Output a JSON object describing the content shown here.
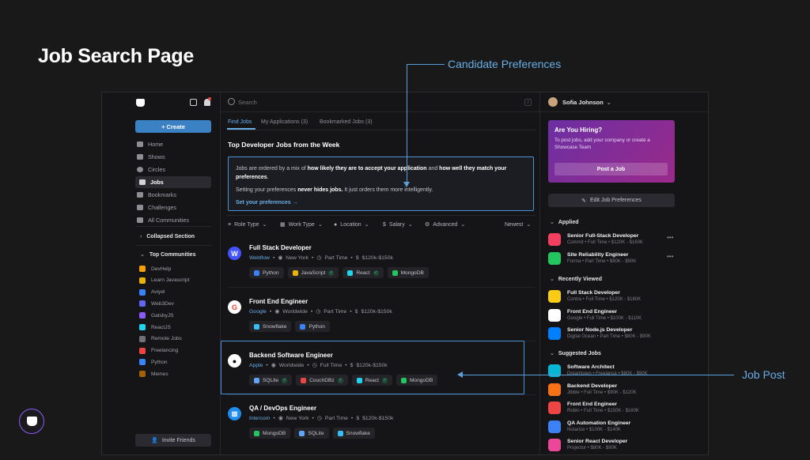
{
  "page_title": "Job Search Page",
  "callouts": {
    "preferences": "Candidate Preferences",
    "job_post": "Job Post"
  },
  "sidebar": {
    "create_label": "+ Create",
    "nav": [
      "Home",
      "Shows",
      "Circles",
      "Jobs",
      "Bookmarks",
      "Challenges",
      "All Communities"
    ],
    "collapsed_section": "Collapsed Section",
    "top_communities": "Top Communities",
    "communities": [
      {
        "name": "DevHelp",
        "color": "#f59e0b"
      },
      {
        "name": "Learn Javascript",
        "color": "#eab308"
      },
      {
        "name": "Aviyel",
        "color": "#3b82f6"
      },
      {
        "name": "Web3Dev",
        "color": "#6366f1"
      },
      {
        "name": "GatsbyJS",
        "color": "#8b5cf6"
      },
      {
        "name": "ReactJS",
        "color": "#22d3ee"
      },
      {
        "name": "Remote Jobs",
        "color": "#71717a"
      },
      {
        "name": "Freelancing",
        "color": "#ef4444"
      },
      {
        "name": "Python",
        "color": "#3b82f6"
      },
      {
        "name": "Memes",
        "color": "#a16207"
      }
    ],
    "invite_label": "Invite Friends"
  },
  "search": {
    "placeholder": "Search",
    "shortcut": "/"
  },
  "tabs": [
    "Find Jobs",
    "My Applications (3)",
    "Bookmarked Jobs (3)"
  ],
  "section_title": "Top Developer Jobs from the Week",
  "info_box": {
    "p1_a": "Jobs are ordered by a mix of ",
    "p1_b": "how likely they are to accept your application",
    "p1_c": " and ",
    "p1_d": "how well they match your preferences",
    "p1_e": ".",
    "p2_a": "Setting your preferences ",
    "p2_b": "never hides jobs.",
    "p2_c": " It just orders them more intelligently.",
    "link": "Set your preferences →"
  },
  "filters": [
    "Role Type",
    "Work Type",
    "Location",
    "Salary",
    "Advanced"
  ],
  "sort": "Newest",
  "jobs": [
    {
      "title": "Full Stack Developer",
      "company": "Webflow",
      "location": "New York",
      "type": "Part Time",
      "salary": "$120k-$150k",
      "logo_color": "#4353ff",
      "logo_text": "W",
      "tags": [
        {
          "name": "Python",
          "color": "#3b82f6",
          "check": false
        },
        {
          "name": "JavaScript",
          "color": "#eab308",
          "check": true
        },
        {
          "name": "React",
          "color": "#22d3ee",
          "check": true
        },
        {
          "name": "MongoDB",
          "color": "#22c55e",
          "check": false
        }
      ]
    },
    {
      "title": "Front End Engineer",
      "company": "Google",
      "location": "Worldwide",
      "type": "Part Time",
      "salary": "$120k-$150k",
      "logo_color": "#ffffff",
      "logo_text": "G",
      "tags": [
        {
          "name": "Snowflake",
          "color": "#38bdf8",
          "check": false
        },
        {
          "name": "Python",
          "color": "#3b82f6",
          "check": false
        }
      ]
    },
    {
      "title": "Backend Software Engineer",
      "company": "Apple",
      "location": "Worldwide",
      "type": "Full Time",
      "salary": "$120k-$150k",
      "logo_color": "#ffffff",
      "logo_text": "",
      "tags": [
        {
          "name": "SQLite",
          "color": "#60a5fa",
          "check": true
        },
        {
          "name": "CouchDBz",
          "color": "#ef4444",
          "check": true
        },
        {
          "name": "React",
          "color": "#22d3ee",
          "check": true
        },
        {
          "name": "MongoDB",
          "color": "#22c55e",
          "check": false
        }
      ]
    },
    {
      "title": "QA / DevOps Engineer",
      "company": "Intercom",
      "location": "New York",
      "type": "Part Time",
      "salary": "$120k-$150k",
      "logo_color": "#1f8ded",
      "logo_text": "",
      "tags": [
        {
          "name": "MongoDB",
          "color": "#22c55e",
          "check": false
        },
        {
          "name": "SQLite",
          "color": "#60a5fa",
          "check": false
        },
        {
          "name": "Snowflake",
          "color": "#38bdf8",
          "check": false
        }
      ]
    }
  ],
  "user": {
    "name": "Sofia Johnson"
  },
  "hiring": {
    "title": "Are You Hiring?",
    "text": "To post jobs, add your company or create a Showcase Team",
    "button": "Post a Job"
  },
  "edit_prefs": "Edit Job Preferences",
  "applied": {
    "title": "Applied",
    "items": [
      {
        "title": "Senior Full-Stack Developer",
        "sub": "Commit • Full Time • $120K - $160K",
        "color": "#f43f5e"
      },
      {
        "title": "Site Reliability Engineer",
        "sub": "Forma • Part Time • $80K - $90K",
        "color": "#22c55e"
      }
    ]
  },
  "recent": {
    "title": "Recently Viewed",
    "items": [
      {
        "title": "Full Stack Developer",
        "sub": "Contra • Full Time • $120K - $160K",
        "color": "#facc15"
      },
      {
        "title": "Front End Engineer",
        "sub": "Google • Full Time • $100K - $110K",
        "color": "#ffffff"
      },
      {
        "title": "Senior Node.js Developer",
        "sub": "Digital Ocean • Part Time • $80K - $90K",
        "color": "#0080ff"
      }
    ]
  },
  "suggested": {
    "title": "Suggested Jobs",
    "items": [
      {
        "title": "Software Architect",
        "sub": "Dreamtown • Freelance • $80K - $90K",
        "color": "#06b6d4"
      },
      {
        "title": "Backend Developer",
        "sub": "Jibble • Full Time • $90K - $120K",
        "color": "#f97316"
      },
      {
        "title": "Front End Engineer",
        "sub": "Robin • Full Time • $150K - $160K",
        "color": "#ef4444"
      },
      {
        "title": "QA Automation Engineer",
        "sub": "Notarize • $100K - $140K",
        "color": "#3b82f6"
      },
      {
        "title": "Senior React Developer",
        "sub": "Projector • $80K - $90K",
        "color": "#ec4899"
      }
    ]
  }
}
